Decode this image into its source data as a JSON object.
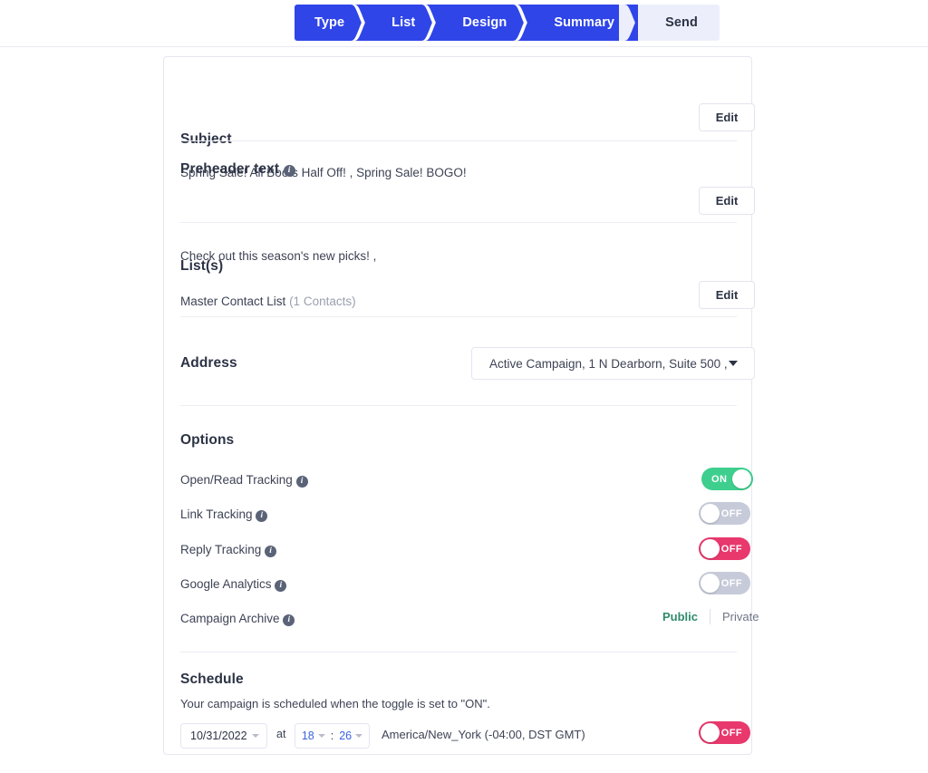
{
  "stepper": {
    "steps": [
      {
        "label": "Type",
        "state": "done"
      },
      {
        "label": "List",
        "state": "done"
      },
      {
        "label": "Design",
        "state": "done"
      },
      {
        "label": "Summary",
        "state": "done"
      },
      {
        "label": "Send",
        "state": "current"
      }
    ],
    "active_color": "#2f45e8",
    "current_bg": "#eceffb"
  },
  "subject": {
    "title": "Subject",
    "value": "Spring Sale! All Boots Half Off! , Spring Sale! BOGO!",
    "edit_label": "Edit"
  },
  "preheader": {
    "title": "Preheader text",
    "info_glyph": "i",
    "value": "Check out this season's new picks! ,",
    "edit_label": "Edit"
  },
  "lists": {
    "title": "List(s)",
    "name": "Master Contact List",
    "count": "(1 Contacts)",
    "edit_label": "Edit"
  },
  "address": {
    "title": "Address",
    "selected": "Active Campaign, 1 N Dearborn, Suite 500 , ..."
  },
  "options": {
    "title": "Options",
    "rows": [
      {
        "label": "Open/Read Tracking",
        "control": "toggle",
        "state": "ON",
        "style": "on",
        "color": "#3ecf8e"
      },
      {
        "label": "Link Tracking",
        "control": "toggle",
        "state": "OFF",
        "style": "off-grey",
        "color": "#c7cbd9"
      },
      {
        "label": "Reply Tracking",
        "control": "toggle",
        "state": "OFF",
        "style": "off-red",
        "color": "#e8386c"
      },
      {
        "label": "Google Analytics",
        "control": "toggle",
        "state": "OFF",
        "style": "off-grey",
        "color": "#c7cbd9"
      },
      {
        "label": "Campaign Archive",
        "control": "segmented",
        "public_label": "Public",
        "private_label": "Private",
        "selected": "Public",
        "selected_color": "#2e8b6b"
      }
    ]
  },
  "schedule": {
    "title": "Schedule",
    "description": "Your campaign is scheduled when the toggle is set to \"ON\".",
    "date": "10/31/2022",
    "at_label": "at",
    "hour": "18",
    "colon": ":",
    "minute": "26",
    "timezone": "America/New_York (-04:00, DST GMT)",
    "toggle_state": "OFF",
    "toggle_color": "#e8386c"
  }
}
